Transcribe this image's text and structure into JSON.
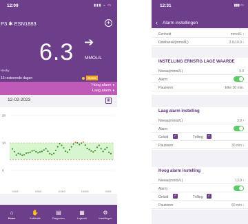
{
  "left": {
    "status_time": "12:09",
    "status_icons": "▮▮▮ ⌁ ▭",
    "device_name": "P3 ✱ ESN1883",
    "glucose_value": "6.3",
    "trend_arrow": "➔",
    "unit": "MMOL/L",
    "period_label": "Hecky",
    "days_remaining": "13 resterende dagen",
    "status_badge": "Status",
    "alarm_high": "Hoog alarm",
    "alarm_low": "Laag alarm",
    "date": "12-02-2023",
    "calendar_icon": "calendar-icon",
    "tabs": [
      {
        "label": "Home",
        "icon": "⌂"
      },
      {
        "label": "Kalibratie",
        "icon": "✋"
      },
      {
        "label": "Rapporten",
        "icon": "▤"
      },
      {
        "label": "Logboek",
        "icon": "▦"
      },
      {
        "label": "Instellingen",
        "icon": "⚙"
      }
    ],
    "colors": {
      "primary": "#6d3e8a",
      "alarm_bar": "#c05ab9",
      "target_band": "#d7f5cf",
      "reading": "#3f8f2e",
      "high": "#e07a2d",
      "low": "#d23b3b"
    }
  },
  "chart_data": {
    "type": "scatter",
    "title": "",
    "xlabel": "",
    "ylabel": "",
    "yticks": [
      0,
      10,
      20
    ],
    "ylim": [
      0,
      22
    ],
    "target_range": [
      3.9,
      10.0
    ],
    "x_tick_labels": [
      "0:00/3",
      "6:00/3",
      "12:00/3",
      "18:00/3",
      "0:00/3"
    ],
    "series": [
      {
        "values": [
          7.8,
          6.8,
          5.6,
          6.2,
          5.9,
          5.5,
          5.7,
          6.3,
          6.4,
          6.6,
          7.1,
          7.3,
          6.8,
          6.4,
          6.7,
          6.9,
          7.4,
          7.9,
          7.0,
          6.1,
          5.8,
          6.2,
          7.3,
          8.6,
          9.7,
          9.1,
          8.2,
          7.0,
          6.6,
          7.5,
          8.6,
          9.6,
          10.2,
          10.0,
          9.4,
          9.9,
          10.3,
          9.2,
          8.0,
          7.6,
          7.1,
          6.7,
          7.2,
          8.4,
          9.1,
          7.9,
          6.9,
          7.7,
          8.3,
          6.6,
          6.1
        ]
      }
    ]
  },
  "right": {
    "status_time": "12:31",
    "status_icons": "▮▮▮ ▭",
    "back_icon": "‹",
    "title": "Alarm instellingen",
    "unit_label": "Eenheid",
    "unit_value": "mmol/L ›",
    "target_label": "Doelbereik(mmol/L)",
    "target_value": "3.9-10.0 ›",
    "urgent": {
      "heading": "INSTELLING ERNSTIG LAGE WAARDE",
      "level_label": "Niveau(mmol/L)",
      "level_value": "3.0",
      "alarm_label": "Alarm",
      "pause_label": "Pauzeren",
      "pause_value": "Elke 30 min."
    },
    "low": {
      "heading": "Laag alarm instelling",
      "level_label": "Niveau(mmol/L)",
      "level_value": "3.9 ›",
      "alarm_label": "Alarm",
      "sound_label": "Geluid",
      "vibrate_label": "Trilling",
      "pause_label": "Pauzeren",
      "pause_value": "30 min ›"
    },
    "high": {
      "heading": "Hoog alarm instelling",
      "level_label": "Niveau(mmol/L)",
      "level_value": "13.0 ›",
      "alarm_label": "Alarm",
      "sound_label": "Geluid",
      "vibrate_label": "Trilling",
      "pause_label": "Pauzeren",
      "pause_value": "60 min ›"
    },
    "toggles": {
      "urgent_alarm": true,
      "low_alarm": true,
      "high_alarm": true
    },
    "checks": {
      "low_sound": true,
      "low_vibrate": true,
      "high_sound": true,
      "high_vibrate": true
    }
  }
}
